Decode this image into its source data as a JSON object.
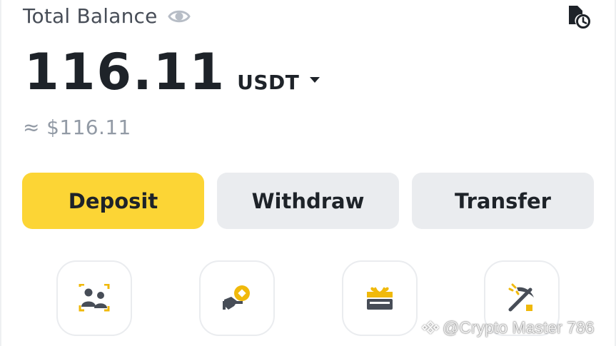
{
  "header": {
    "title": "Total Balance",
    "visibility_icon": "eye-icon",
    "history_icon": "history-icon"
  },
  "balance": {
    "amount": "116.11",
    "currency": "USDT",
    "currency_dropdown_icon": "caret-down-icon",
    "fiat_equivalent": "≈ $116.11"
  },
  "actions": {
    "deposit_label": "Deposit",
    "withdraw_label": "Withdraw",
    "transfer_label": "Transfer"
  },
  "shortcuts": {
    "items": [
      {
        "icon": "people-scan-icon"
      },
      {
        "icon": "coin-hand-icon"
      },
      {
        "icon": "gift-card-icon"
      },
      {
        "icon": "pickaxe-icon"
      }
    ]
  },
  "watermark": {
    "text": "@Crypto Master 786",
    "icon": "binance-logo-icon"
  },
  "colors": {
    "accent_yellow": "#FCD535",
    "text_primary": "#1E2329",
    "text_secondary": "#929AA5",
    "button_gray": "#EAECEF"
  }
}
